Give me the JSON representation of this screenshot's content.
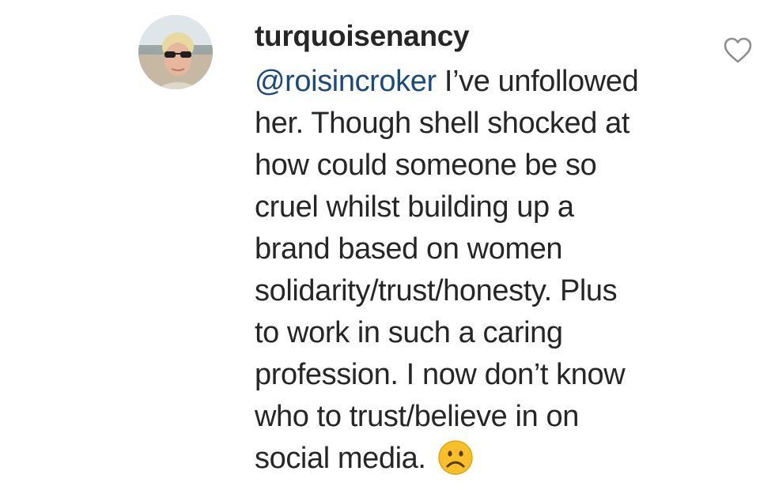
{
  "comment": {
    "username": "turquoisenancy",
    "mention": "@roisincroker",
    "lines": [
      " I’ve unfollowed",
      "her. Though shell shocked at",
      "how could someone be so",
      "cruel whilst building up a",
      "brand based on women",
      "solidarity/trust/honesty. Plus",
      "to work in such a caring",
      "profession. I now don’t know",
      "who to trust/believe in on",
      "social media. "
    ],
    "emoji": "frowning-face",
    "like_icon": "heart-outline-icon"
  },
  "colors": {
    "text": "#262626",
    "mention": "#1b4a7d",
    "emoji_face": "#f7c02a",
    "heart_stroke": "#8e8e8e"
  }
}
